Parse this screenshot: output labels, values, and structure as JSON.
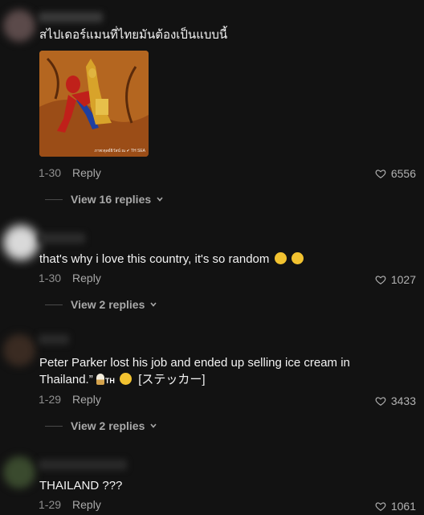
{
  "comments": [
    {
      "text": "สไปเดอร์แมนที่ไทยมันต้องเป็นแบบนี้",
      "date": "1-30",
      "reply_label": "Reply",
      "likes": "6556",
      "view_replies": "View 16 replies",
      "image_watermark": "ภาพ:ตุลย์ธิวัสน์ ณ ✔ TH SEA"
    },
    {
      "text": "that's why i love this country, it's so random",
      "date": "1-30",
      "reply_label": "Reply",
      "likes": "1027",
      "view_replies": "View 2 replies"
    },
    {
      "text_line1": "Peter Parker lost his job and ended up selling ice cream in",
      "text_line2_prefix": "Thailand.”",
      "text_line2_th": "TH",
      "text_line2_suffix": "[ステッカー]",
      "date": "1-29",
      "reply_label": "Reply",
      "likes": "3433",
      "view_replies": "View 2 replies"
    },
    {
      "text": "THAILAND ???",
      "date": "1-29",
      "reply_label": "Reply",
      "likes": "1061"
    }
  ],
  "colors": {
    "background": "#121212",
    "emoji": "#f2c230"
  },
  "icons": [
    "heart-outline-icon",
    "chevron-down-icon",
    "laughing-emoji-icon"
  ]
}
